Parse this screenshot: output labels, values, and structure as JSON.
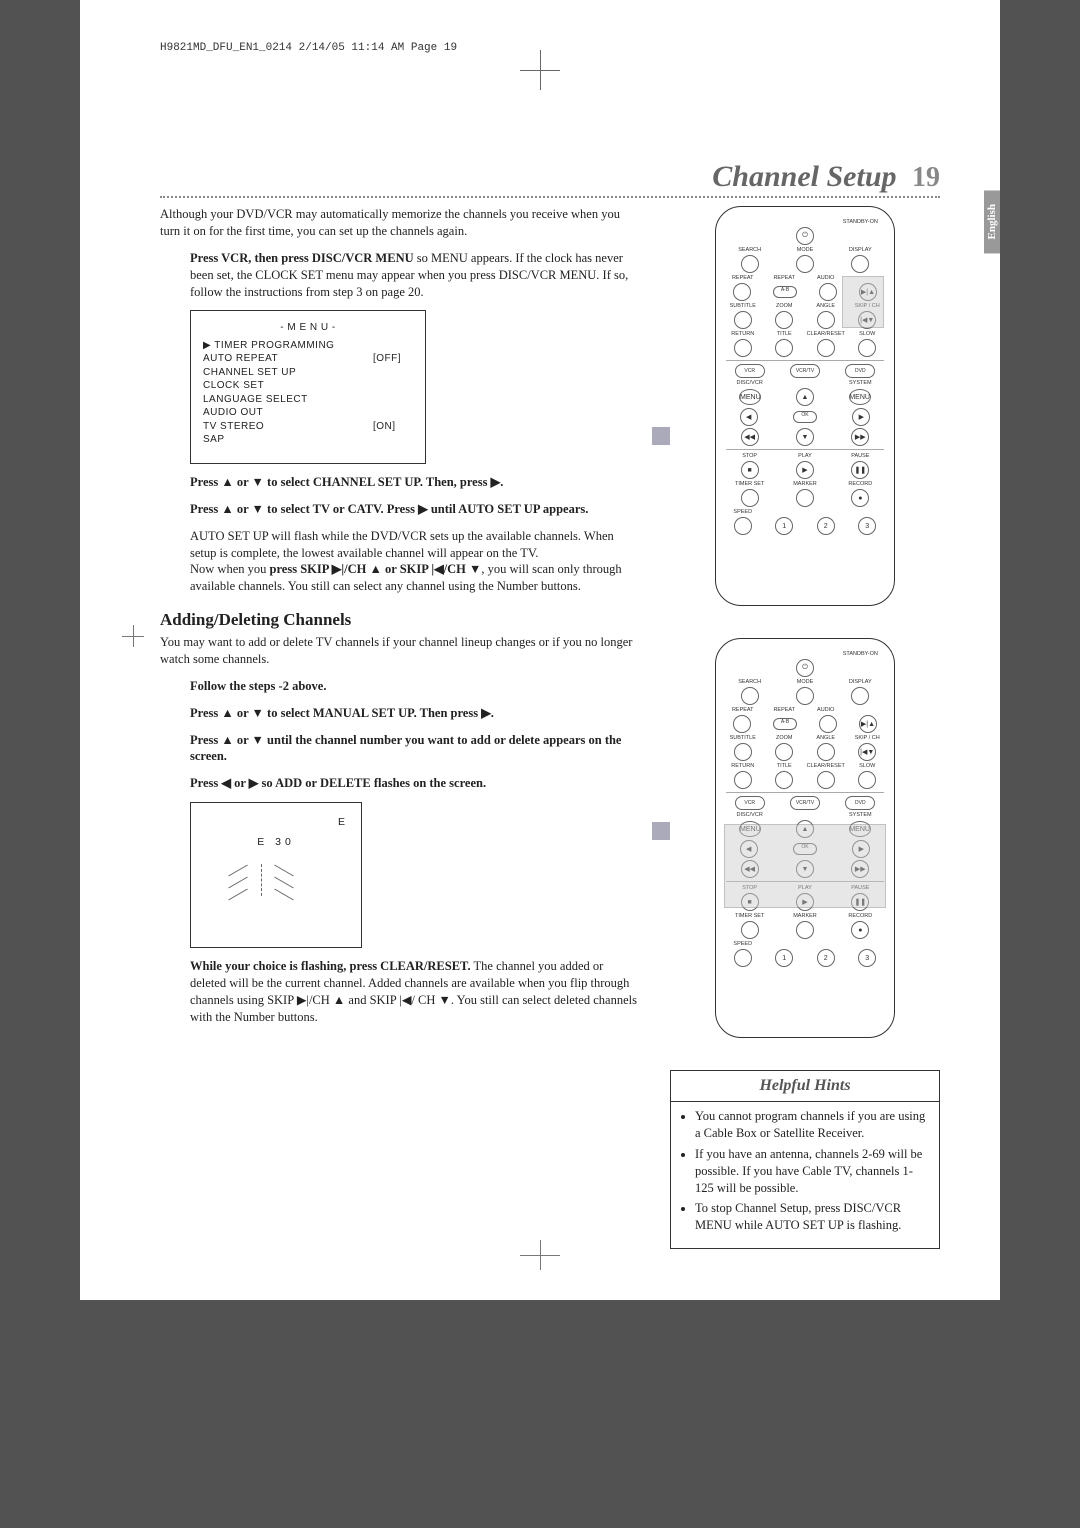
{
  "header_meta": "H9821MD_DFU_EN1_0214  2/14/05  11:14 AM  Page 19",
  "chapter_title": "Channel Setup",
  "page_number": "19",
  "language_tab": "English",
  "intro_text": "Although your DVD/VCR may automatically memorize the channels you receive when you turn it on for the first time, you can set up the channels again.",
  "step1_lead": "Press VCR, then press DISC/VCR MENU",
  "step1_rest": " so MENU appears. If the clock has never been set, the CLOCK SET menu may appear when you press DISC/VCR MENU. If so, follow the instructions from step 3 on page 20.",
  "menu_title": "- M E N U -",
  "menu_items": [
    {
      "label": "▶ TIMER PROGRAMMING",
      "val": ""
    },
    {
      "label": "AUTO REPEAT",
      "val": "[OFF]"
    },
    {
      "label": "CHANNEL SET UP",
      "val": ""
    },
    {
      "label": "CLOCK SET",
      "val": ""
    },
    {
      "label": "LANGUAGE SELECT",
      "val": ""
    },
    {
      "label": "AUDIO OUT",
      "val": ""
    },
    {
      "label": "TV STEREO",
      "val": "[ON]"
    },
    {
      "label": "SAP",
      "val": ""
    }
  ],
  "step2": "Press ▲ or ▼ to select CHANNEL SET UP. Then, press ▶.",
  "step3": "Press ▲ or ▼ to select TV or CATV. Press ▶ until AUTO SET UP appears.",
  "step3_follow1": "AUTO SET UP will flash while the DVD/VCR sets up the available channels. When setup is complete, the lowest available channel will appear on the TV.",
  "step3_follow2a": "Now when you ",
  "step3_follow2b": "press SKIP ▶|/CH ▲ or SKIP |◀/CH ▼",
  "step3_follow2c": ", you will scan only through available channels. You still can select any channel using the Number buttons.",
  "adding_heading": "Adding/Deleting Channels",
  "adding_intro": "You may want to add or delete TV channels if your channel lineup changes or if you no longer watch some channels.",
  "astep1": "Follow the steps   -2 above.",
  "astep2": "Press ▲ or ▼ to select MANUAL SET UP. Then press ▶.",
  "astep3": "Press ▲ or ▼ until the channel number you want to add or delete appears on the screen.",
  "astep4": "Press ◀ or ▶ so ADD or DELETE flashes on the screen.",
  "chbox_line1": "E",
  "chbox_line2": "E   30",
  "astep5_lead": "While your choice is flashing, press CLEAR/RESET.",
  "astep5_rest": " The channel you added or deleted will be the current channel. Added channels are available when you flip through channels using SKIP ▶|/CH ▲ and SKIP |◀/ CH ▼. You still can select deleted channels with the Number buttons.",
  "hints_title": "Helpful Hints",
  "hints": [
    "You cannot program channels if you are using a Cable Box or Satellite Receiver.",
    "If you have an antenna, channels 2-69 will be possible. If you have Cable TV, channels 1-125 will be possible.",
    "To stop Channel Setup, press DISC/VCR MENU while AUTO SET UP is flashing."
  ],
  "remote": {
    "standby": "STANDBY-ON",
    "row1": [
      "SEARCH",
      "MODE",
      "DISPLAY"
    ],
    "row2": [
      "REPEAT",
      "REPEAT",
      "AUDIO"
    ],
    "ab": "A-B",
    "row3": [
      "SUBTITLE",
      "ZOOM",
      "ANGLE",
      "SKIP / CH"
    ],
    "row4": [
      "RETURN",
      "TITLE",
      "CLEAR/RESET",
      "SLOW"
    ],
    "row5": [
      "VCR",
      "VCR/TV",
      "DVD"
    ],
    "row6": [
      "DISC/VCR",
      "",
      "SYSTEM"
    ],
    "menu": "MENU",
    "ok": "OK",
    "row7": [
      "STOP",
      "PLAY",
      "PAUSE"
    ],
    "row8": [
      "TIMER SET",
      "MARKER",
      "RECORD"
    ],
    "speed": "SPEED",
    "nums": [
      "1",
      "2",
      "3"
    ]
  }
}
